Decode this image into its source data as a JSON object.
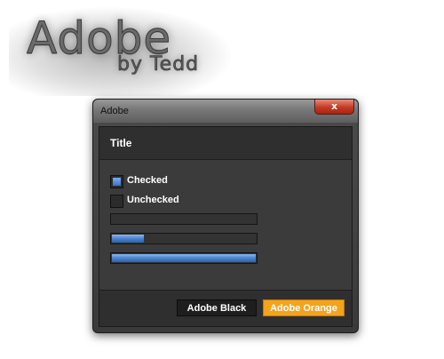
{
  "logo": {
    "main": "Adobe",
    "sub": "by Tedd"
  },
  "window": {
    "title": "Adobe",
    "close_glyph": "x",
    "close_icon": "close-icon"
  },
  "panel": {
    "header_title": "Title",
    "checkboxes": [
      {
        "label": "Checked",
        "checked": true
      },
      {
        "label": "Unchecked",
        "checked": false
      }
    ],
    "progress_bars": [
      {
        "value_percent": 0
      },
      {
        "value_percent": 23
      },
      {
        "value_percent": 100
      }
    ]
  },
  "footer": {
    "buttons": [
      {
        "label": "Adobe Black",
        "color": "#1e1e1e"
      },
      {
        "label": "Adobe Orange",
        "color": "#f5a31a"
      }
    ]
  },
  "colors": {
    "accent_blue": "#4a83cf",
    "accent_orange": "#f5a31a",
    "panel_bg": "#3b3b3b"
  }
}
